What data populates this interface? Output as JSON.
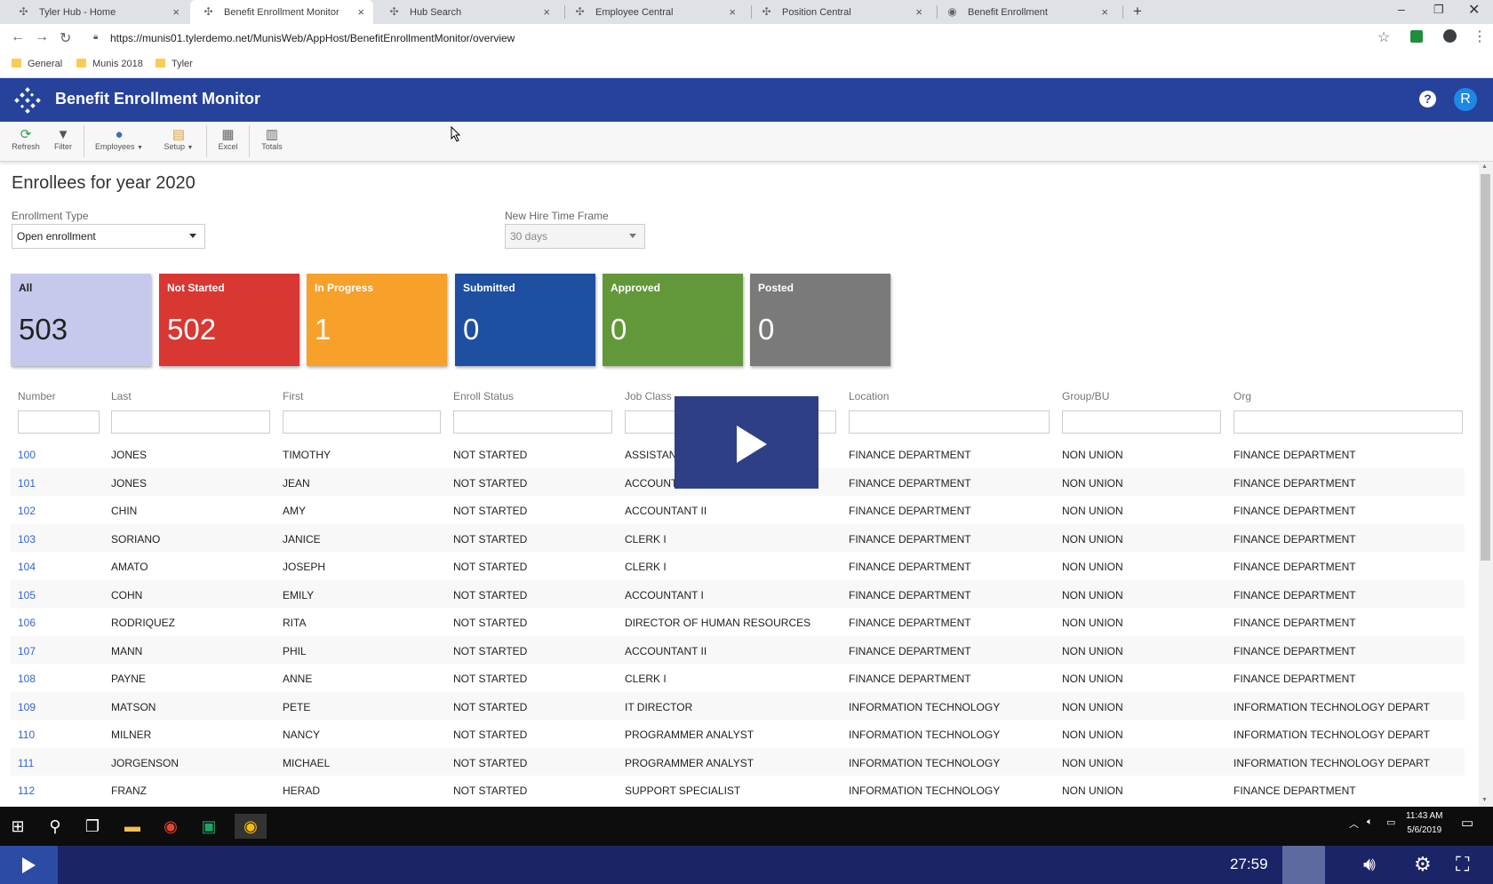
{
  "browser": {
    "tabs": [
      {
        "title": "Tyler Hub - Home",
        "active": false
      },
      {
        "title": "Benefit Enrollment Monitor",
        "active": true
      },
      {
        "title": "Hub Search",
        "active": false
      },
      {
        "title": "Employee Central",
        "active": false
      },
      {
        "title": "Position Central",
        "active": false
      },
      {
        "title": "Benefit Enrollment",
        "active": false
      }
    ],
    "new_tab": "+",
    "url": "https://munis01.tylerdemo.net/MunisWeb/AppHost/BenefitEnrollmentMonitor/overview",
    "bookmarks": [
      "General",
      "Munis 2018",
      "Tyler"
    ]
  },
  "app": {
    "title": "Benefit Enrollment Monitor",
    "help_icon": "?",
    "user_initial": "R",
    "brand_color": "#27429a"
  },
  "toolbar": {
    "items": [
      {
        "label": "Refresh",
        "icon": "refresh-icon"
      },
      {
        "label": "Filter",
        "icon": "filter-icon"
      },
      {
        "label": "Employees",
        "icon": "employees-icon"
      },
      {
        "label": "Setup",
        "icon": "setup-icon"
      },
      {
        "label": "Excel",
        "icon": "excel-icon"
      },
      {
        "label": "Totals",
        "icon": "totals-icon"
      }
    ]
  },
  "page": {
    "title": "Enrollees for year 2020",
    "enrollment_type": {
      "label": "Enrollment Type",
      "value": "Open enrollment"
    },
    "new_hire": {
      "label": "New Hire Time Frame",
      "value": "30 days"
    }
  },
  "tiles": [
    {
      "label": "All",
      "count": "503",
      "color": "#c7c9ec"
    },
    {
      "label": "Not Started",
      "count": "502",
      "color": "#d93732"
    },
    {
      "label": "In Progress",
      "count": "1",
      "color": "#f7a12a"
    },
    {
      "label": "Submitted",
      "count": "0",
      "color": "#1e4fa0"
    },
    {
      "label": "Approved",
      "count": "0",
      "color": "#62983a"
    },
    {
      "label": "Posted",
      "count": "0",
      "color": "#7a7a7a"
    }
  ],
  "table": {
    "columns": [
      "Number",
      "Last",
      "First",
      "Enroll Status",
      "Job Class",
      "Location",
      "Group/BU",
      "Org"
    ],
    "rows": [
      [
        "100",
        "JONES",
        "TIMOTHY",
        "NOT STARTED",
        "ASSISTANT",
        "FINANCE DEPARTMENT",
        "NON UNION",
        "FINANCE DEPARTMENT"
      ],
      [
        "101",
        "JONES",
        "JEAN",
        "NOT STARTED",
        "ACCOUNT",
        "FINANCE DEPARTMENT",
        "NON UNION",
        "FINANCE DEPARTMENT"
      ],
      [
        "102",
        "CHIN",
        "AMY",
        "NOT STARTED",
        "ACCOUNTANT II",
        "FINANCE DEPARTMENT",
        "NON UNION",
        "FINANCE DEPARTMENT"
      ],
      [
        "103",
        "SORIANO",
        "JANICE",
        "NOT STARTED",
        "CLERK I",
        "FINANCE DEPARTMENT",
        "NON UNION",
        "FINANCE DEPARTMENT"
      ],
      [
        "104",
        "AMATO",
        "JOSEPH",
        "NOT STARTED",
        "CLERK I",
        "FINANCE DEPARTMENT",
        "NON UNION",
        "FINANCE DEPARTMENT"
      ],
      [
        "105",
        "COHN",
        "EMILY",
        "NOT STARTED",
        "ACCOUNTANT I",
        "FINANCE DEPARTMENT",
        "NON UNION",
        "FINANCE DEPARTMENT"
      ],
      [
        "106",
        "RODRIQUEZ",
        "RITA",
        "NOT STARTED",
        "DIRECTOR OF HUMAN RESOURCES",
        "FINANCE DEPARTMENT",
        "NON UNION",
        "FINANCE DEPARTMENT"
      ],
      [
        "107",
        "MANN",
        "PHIL",
        "NOT STARTED",
        "ACCOUNTANT II",
        "FINANCE DEPARTMENT",
        "NON UNION",
        "FINANCE DEPARTMENT"
      ],
      [
        "108",
        "PAYNE",
        "ANNE",
        "NOT STARTED",
        "CLERK I",
        "FINANCE DEPARTMENT",
        "NON UNION",
        "FINANCE DEPARTMENT"
      ],
      [
        "109",
        "MATSON",
        "PETE",
        "NOT STARTED",
        "IT DIRECTOR",
        "INFORMATION TECHNOLOGY",
        "NON UNION",
        "INFORMATION TECHNOLOGY DEPART"
      ],
      [
        "110",
        "MILNER",
        "NANCY",
        "NOT STARTED",
        "PROGRAMMER ANALYST",
        "INFORMATION TECHNOLOGY",
        "NON UNION",
        "INFORMATION TECHNOLOGY DEPART"
      ],
      [
        "111",
        "JORGENSON",
        "MICHAEL",
        "NOT STARTED",
        "PROGRAMMER ANALYST",
        "INFORMATION TECHNOLOGY",
        "NON UNION",
        "INFORMATION TECHNOLOGY DEPART"
      ],
      [
        "112",
        "FRANZ",
        "HERAD",
        "NOT STARTED",
        "SUPPORT SPECIALIST",
        "INFORMATION TECHNOLOGY",
        "NON UNION",
        "FINANCE DEPARTMENT"
      ]
    ]
  },
  "taskbar": {
    "time": "11:43 AM",
    "date": "5/6/2019"
  },
  "player": {
    "time": "27:59"
  }
}
